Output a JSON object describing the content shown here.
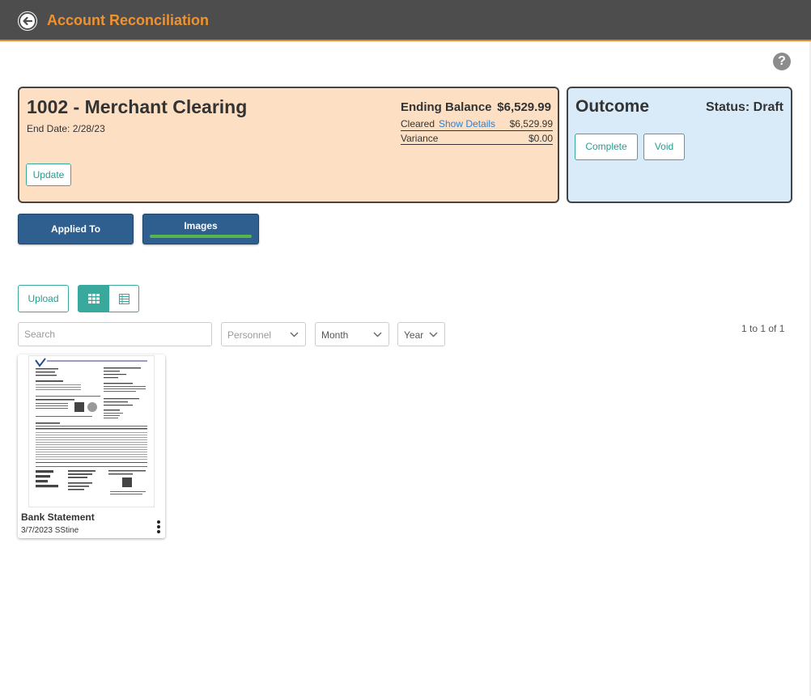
{
  "header": {
    "title": "Account Reconciliation",
    "back_icon": "back-arrow-icon"
  },
  "help": {
    "icon": "help-icon",
    "glyph": "?"
  },
  "account": {
    "title": "1002 - Merchant Clearing",
    "end_date": "End Date: 2/28/23",
    "update_label": "Update",
    "ending_balance_label": "Ending Balance",
    "ending_balance_value": "$6,529.99",
    "cleared_label": "Cleared",
    "show_details_label": "Show Details",
    "cleared_value": "$6,529.99",
    "variance_label": "Variance",
    "variance_value": "$0.00"
  },
  "outcome": {
    "title": "Outcome",
    "status": "Status: Draft",
    "complete_label": "Complete",
    "void_label": "Void"
  },
  "tabs": [
    {
      "label": "Applied To",
      "active": false
    },
    {
      "label": "Images",
      "active": true
    }
  ],
  "toolbar": {
    "upload_label": "Upload",
    "grid_view_icon": "grid-view-icon",
    "list_view_icon": "list-view-icon",
    "active_view": "grid"
  },
  "filters": {
    "search_placeholder": "Search",
    "personnel": "Personnel",
    "month": "Month",
    "year": "Year"
  },
  "pagination": "1 to 1 of 1",
  "images": [
    {
      "title": "Bank Statement",
      "meta": "3/7/2023 SStine",
      "thumbnail": "bank-statement-thumbnail"
    }
  ],
  "colors": {
    "header_bg": "#4d4d4d",
    "accent": "#f0922e",
    "teal": "#39a99e",
    "tab_bg": "#2f5f8f",
    "tab_active_bar": "#58b44d",
    "account_card_bg": "#fde0c4",
    "outcome_card_bg": "#d9ebf9",
    "link": "#2b7fd6"
  }
}
